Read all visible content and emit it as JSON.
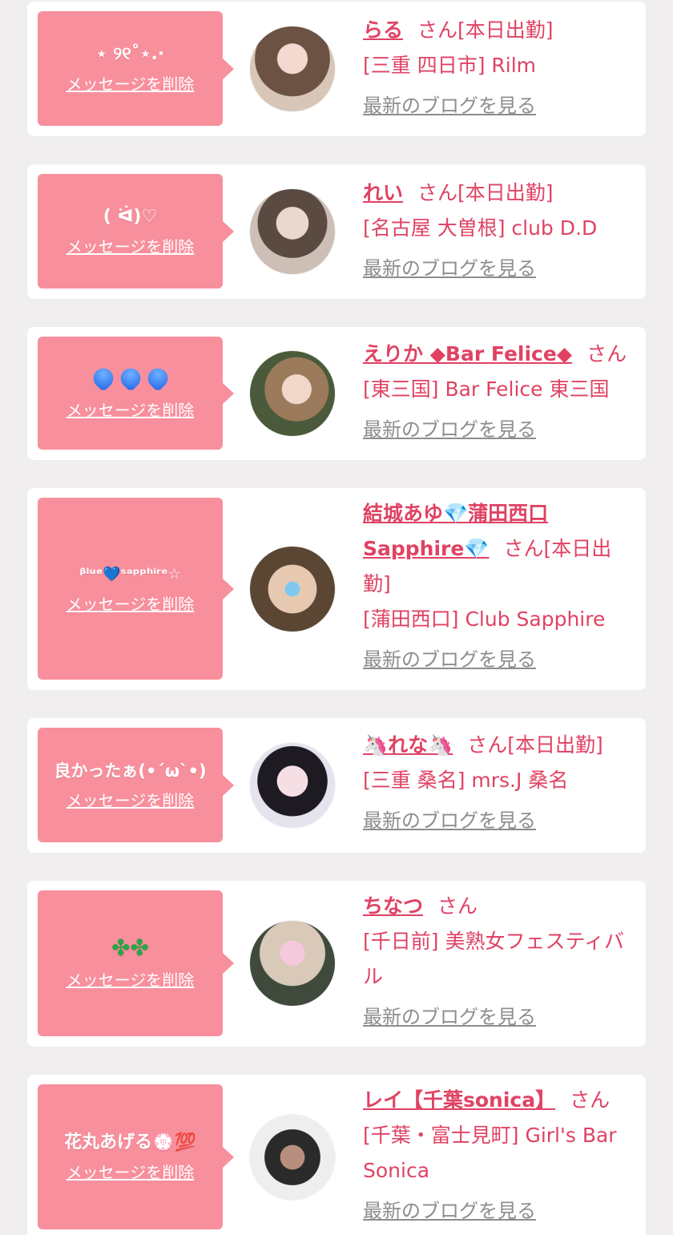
{
  "delete_label": "メッセージを削除",
  "blog_label": "最新のブログを見る",
  "san_label": "さん",
  "cards": [
    {
      "message": "⋆ ୨୧˚⋆.·",
      "name": "らる",
      "status": "[本日出勤]",
      "location": "[三重 四日市] Rilm",
      "avatar_icon": "avatar-photo"
    },
    {
      "message": "( ᐛ)♡",
      "name": "れい",
      "status": "[本日出勤]",
      "location": "[名古屋 大曽根] club D.D",
      "avatar_icon": "avatar-photo"
    },
    {
      "message": "💙💙💙",
      "name": "えりか ◆Bar Felice◆",
      "status": "",
      "location": "[東三国] Bar Felice 東三国",
      "avatar_icon": "avatar-photo"
    },
    {
      "message": "ᵝˡᵘᵉ💙ˢᵃᵖᵖʰⁱʳᵉ☆",
      "name": "結城あゆ💎蒲田西口Sapphire💎",
      "status": "[本日出勤]",
      "location": "[蒲田西口] Club Sapphire",
      "avatar_icon": "avatar-photo"
    },
    {
      "message": "良かったぁ(•´ω`•)",
      "name": "🦄れな🦄",
      "status": "[本日出勤]",
      "location": "[三重 桑名] mrs.J 桑名",
      "avatar_icon": "avatar-photo"
    },
    {
      "message": "🍀🍀",
      "name": "ちなつ",
      "status": "",
      "location": "[千日前] 美熟女フェスティバル",
      "avatar_icon": "avatar-photo"
    },
    {
      "message": "花丸あげる💮💯",
      "name": "レイ【千葉sonica】",
      "status": "",
      "location": "[千葉・富士見町] Girl's Bar Sonica",
      "avatar_icon": "avatar-photo"
    }
  ]
}
